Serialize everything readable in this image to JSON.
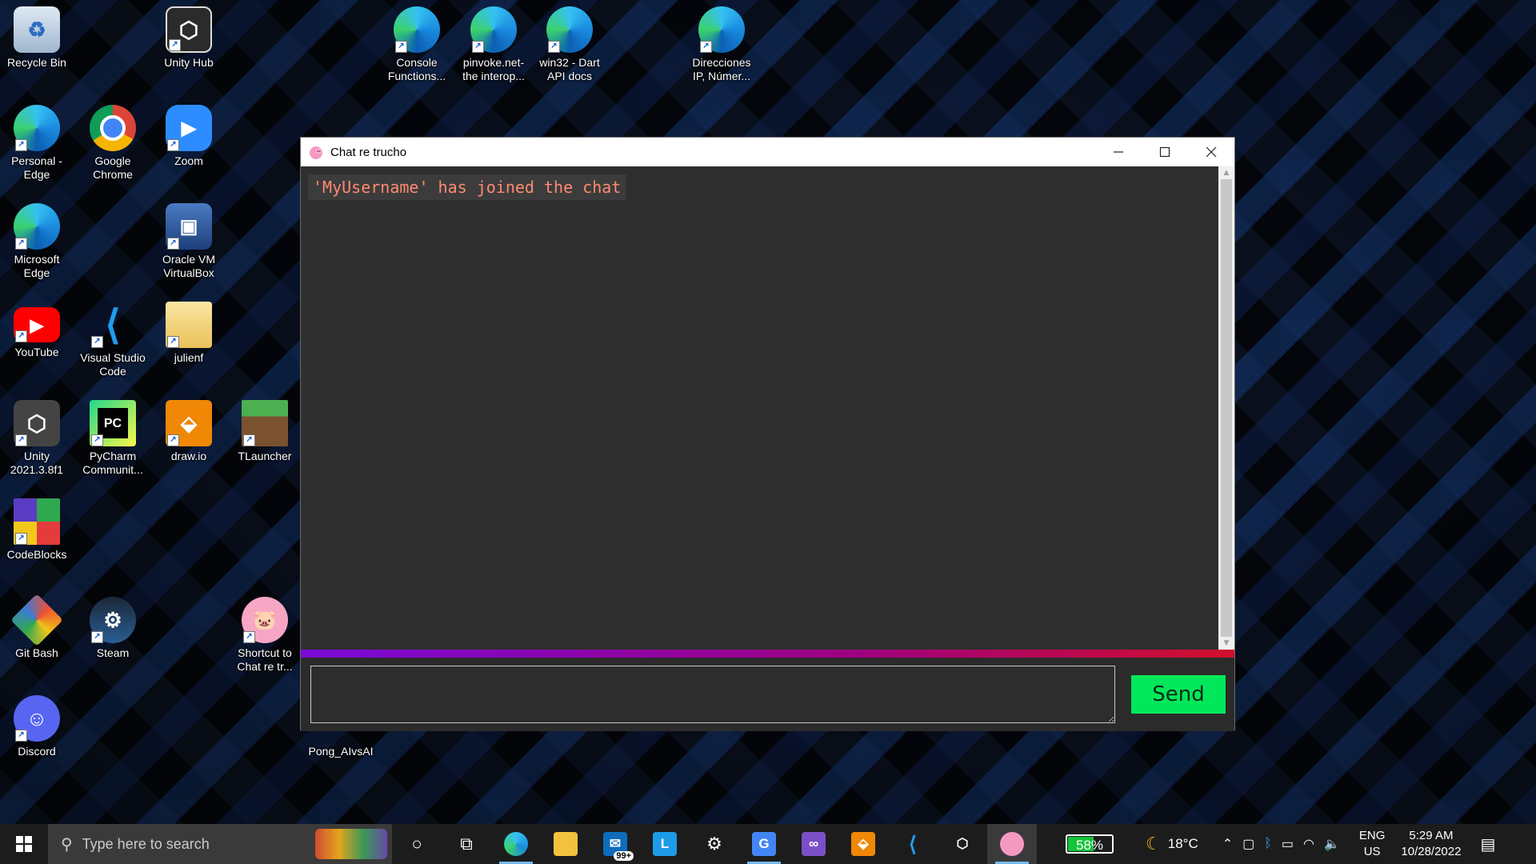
{
  "desktop": {
    "icons": [
      {
        "label": "Recycle Bin",
        "icon": "recycle-bin-icon"
      },
      {
        "label": "Unity Hub",
        "icon": "unity-hub-icon"
      },
      {
        "label": "Console Functions...",
        "icon": "edge-icon"
      },
      {
        "label": "pinvoke.net- the interop...",
        "icon": "edge-icon"
      },
      {
        "label": "win32 - Dart API docs",
        "icon": "edge-icon"
      },
      {
        "label": "Direcciones IP, Númer...",
        "icon": "edge-icon"
      },
      {
        "label": "Personal - Edge",
        "icon": "edge-icon"
      },
      {
        "label": "Google Chrome",
        "icon": "chrome-icon"
      },
      {
        "label": "Zoom",
        "icon": "zoom-icon"
      },
      {
        "label": "Microsoft Edge",
        "icon": "edge-icon"
      },
      {
        "label": "Oracle VM VirtualBox",
        "icon": "virtualbox-icon"
      },
      {
        "label": "YouTube",
        "icon": "youtube-icon"
      },
      {
        "label": "Visual Studio Code",
        "icon": "vscode-icon"
      },
      {
        "label": "julienf",
        "icon": "folder-icon"
      },
      {
        "label": "Unity 2021.3.8f1",
        "icon": "unity-icon"
      },
      {
        "label": "PyCharm Communit...",
        "icon": "pycharm-icon"
      },
      {
        "label": "draw.io",
        "icon": "drawio-icon"
      },
      {
        "label": "TLauncher",
        "icon": "tlauncher-icon"
      },
      {
        "label": "CodeBlocks",
        "icon": "codeblocks-icon"
      },
      {
        "label": "Git Bash",
        "icon": "git-bash-icon"
      },
      {
        "label": "Steam",
        "icon": "steam-icon"
      },
      {
        "label": "Shortcut to Chat re tr...",
        "icon": "peppa-pig-icon"
      },
      {
        "label": "Discord",
        "icon": "discord-icon"
      },
      {
        "label": "Pong_AIvsAI",
        "icon": "file-icon"
      }
    ]
  },
  "chat_window": {
    "title": "Chat re trucho",
    "messages": [
      "'MyUsername' has joined the chat"
    ],
    "input_value": "",
    "send_label": "Send",
    "colors": {
      "message_text": "#ff8a70",
      "send_button": "#00e85a",
      "divider_start": "#7a0ad8",
      "divider_end": "#d0102a"
    }
  },
  "taskbar": {
    "search_placeholder": "Type here to search",
    "mail_badge": "99+",
    "battery_percent": "58%",
    "weather_temp": "18°C",
    "lang_line1": "ENG",
    "lang_line2": "US",
    "time": "5:29 AM",
    "date": "10/28/2022"
  }
}
